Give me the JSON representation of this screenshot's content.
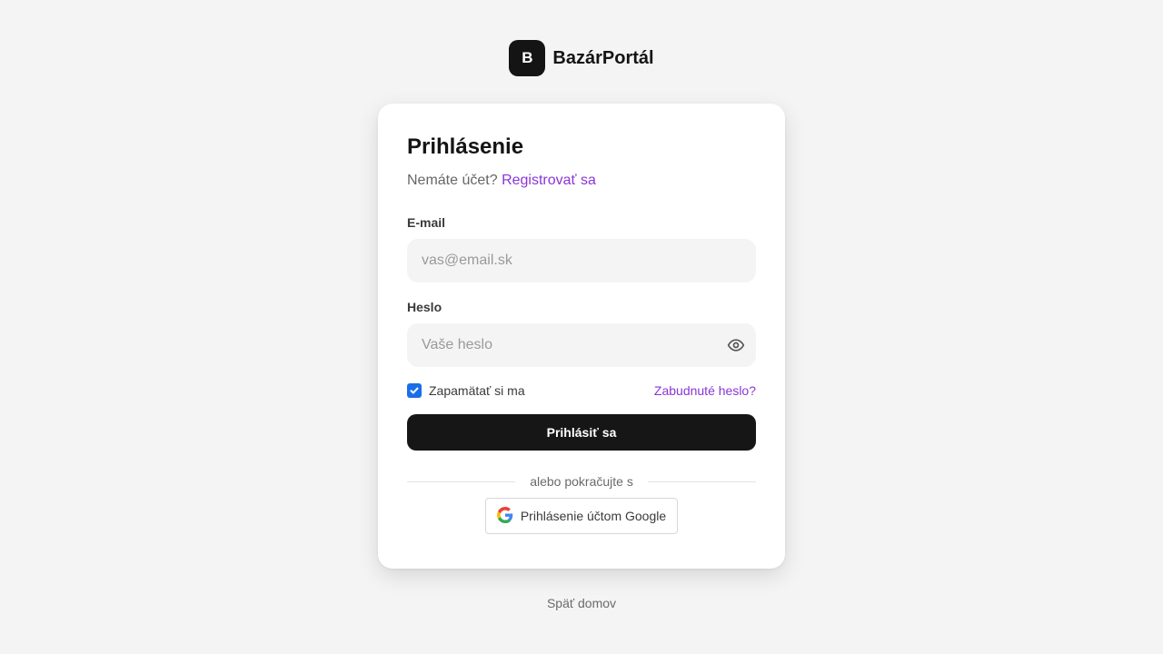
{
  "brand": {
    "logo_letter": "B",
    "name": "BazárPortál"
  },
  "login": {
    "title": "Prihlásenie",
    "no_account_text": "Nemáte účet?",
    "register_link": "Registrovať sa",
    "email_label": "E-mail",
    "email_placeholder": "vas@email.sk",
    "email_value": "",
    "password_label": "Heslo",
    "password_placeholder": "Vaše heslo",
    "password_value": "",
    "remember_label": "Zapamätať si ma",
    "remember_checked": true,
    "forgot_link": "Zabudnuté heslo?",
    "submit_label": "Prihlásiť sa",
    "divider_text": "alebo pokračujte s",
    "google_button_label": "Prihlásenie účtom Google"
  },
  "footer": {
    "back_link": "Späť domov"
  },
  "colors": {
    "accent": "#8a35d6",
    "primary_button": "#161616",
    "checkbox": "#1a6ee8",
    "background": "#f4f4f4"
  },
  "icons": {
    "password_toggle": "eye-icon",
    "google": "google-icon",
    "checkbox": "check-icon"
  }
}
